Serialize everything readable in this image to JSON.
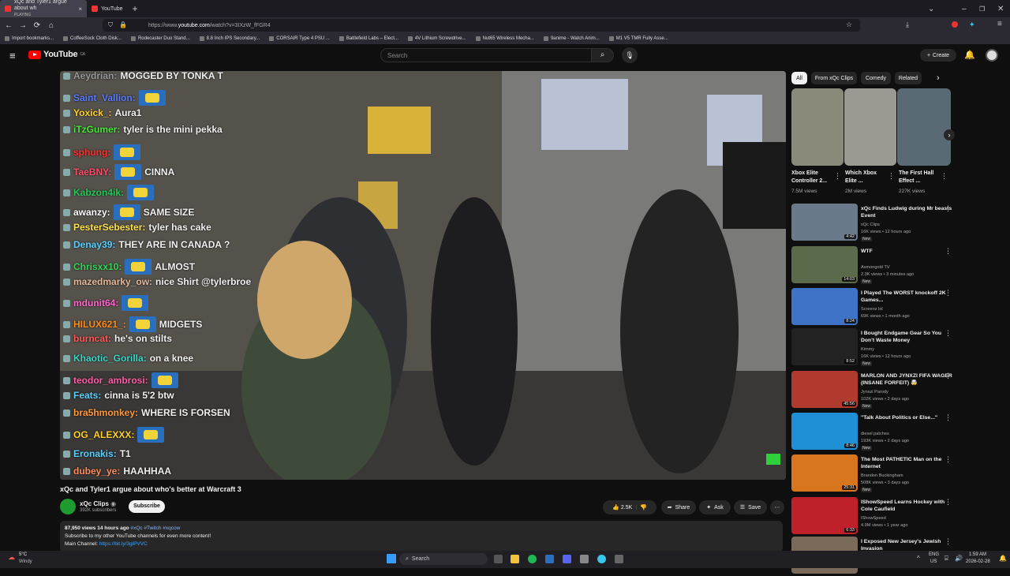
{
  "browser": {
    "tabs": [
      {
        "title": "xQc and Tyler1 argue about wh",
        "sub": "PLAYING",
        "close": "×"
      },
      {
        "title": "YouTube"
      }
    ],
    "newtab": "+",
    "url_prefix": "https://www.",
    "url_domain": "youtube.com",
    "url_path": "/watch?v=3IXzW_fFGR4",
    "bookmarks": [
      "Import bookmarks...",
      "CoffeeSock Cloth Disk...",
      "Rodecaster Duo Stand...",
      "8.8 Inch IPS Secondary...",
      "CORSAIR Type 4 PSU ...",
      "Battlefield Labs – Elect...",
      "4V Lithium Screwdrive...",
      "Nut65 Wireless Mecha...",
      "9anime - Watch Anim...",
      "M1 V5 TMR Fully Asse..."
    ]
  },
  "youtube": {
    "logo": "YouTube",
    "logo_region": "CA",
    "search_placeholder": "Search",
    "create_label": "Create"
  },
  "chat": [
    {
      "user": "Aeydrian:",
      "msg": "MOGGED BY TONKA T",
      "color": "#9a9a9a",
      "emote": false
    },
    {
      "user": "Saint_Vallion:",
      "msg": "",
      "color": "#5b7bff",
      "emote": true
    },
    {
      "user": "Yoxick_:",
      "msg": "Aura1",
      "color": "#ffd21f",
      "emote": false
    },
    {
      "user": "iTzGumer:",
      "msg": "tyler is the mini pekka",
      "color": "#47e83a",
      "emote": false
    },
    {
      "user": "sphung:",
      "msg": "",
      "color": "#ff3030",
      "emote": true
    },
    {
      "user": "TaeBNY:",
      "msg": "CINNA",
      "color": "#ff4d6a",
      "emote": true
    },
    {
      "user": "Kabzon4ik:",
      "msg": "",
      "color": "#27c95a",
      "emote": true
    },
    {
      "user": "awanzy:",
      "msg": "SAME SIZE",
      "color": "#ffffff",
      "emote": true
    },
    {
      "user": "PesterSebester:",
      "msg": "tyler has cake",
      "color": "#ffe14a",
      "emote": false
    },
    {
      "user": "Denay39:",
      "msg": "THEY ARE IN CANADA ?",
      "color": "#5ad0ff",
      "emote": false
    },
    {
      "user": "Chrisxx10:",
      "msg": "ALMOST",
      "color": "#3ad65a",
      "emote": true
    },
    {
      "user": "mazedmarky_ow:",
      "msg": "nice Shirt @tylerbroe",
      "color": "#e6b89a",
      "emote": false
    },
    {
      "user": "mdunit64:",
      "msg": "",
      "color": "#ff66cc",
      "emote": true
    },
    {
      "user": "HILUX621_:",
      "msg": "MIDGETS",
      "color": "#ff8c1a",
      "emote": true
    },
    {
      "user": "burncat:",
      "msg": "he's on stilts",
      "color": "#ff5a5a",
      "emote": false
    },
    {
      "user": "Khaotic_Gorilla:",
      "msg": "on a knee",
      "color": "#3ad6c8",
      "emote": false
    },
    {
      "user": "teodor_ambrosi:",
      "msg": "",
      "color": "#ff5ea8",
      "emote": true
    },
    {
      "user": "Feats:",
      "msg": "cinna is 5'2 btw",
      "color": "#5ad0ff",
      "emote": false
    },
    {
      "user": "bra5hmonkey:",
      "msg": "WHERE IS FORSEN",
      "color": "#ff9a3a",
      "emote": false
    },
    {
      "user": "OG_ALEXXX:",
      "msg": "",
      "color": "#ffd21f",
      "emote": true
    },
    {
      "user": "Eronakis:",
      "msg": "T1",
      "color": "#5ad0ff",
      "emote": false
    },
    {
      "user": "dubey_ye:",
      "msg": "HAAHHAA",
      "color": "#ff8c5a",
      "emote": false
    }
  ],
  "video": {
    "title": "xQc and Tyler1 argue about who's better at Warcraft 3",
    "channel": "xQc Clips",
    "subscribers": "392K subscribers",
    "subscribe_label": "Subscribe",
    "likes": "2.5K",
    "share_label": "Share",
    "ask_label": "Ask",
    "save_label": "Save",
    "views_line": "87,950 views  14 hours ago",
    "tags": "#xQc #Twitch #xqcow",
    "desc_line1": "Subscribe to my other YouTube channels for even more content!",
    "desc_line2_prefix": "Main Channel: ",
    "desc_link": "https://bit.ly/3glPVVC"
  },
  "chips": [
    "All",
    "From xQc Clips",
    "Comedy",
    "Related"
  ],
  "shorts": [
    {
      "title": "Xbox Elite Controller 2...",
      "views": "7.5M views"
    },
    {
      "title": "Which Xbox Elite ...",
      "views": "2M views"
    },
    {
      "title": "The First Hall Effect ...",
      "views": "227K views"
    }
  ],
  "related": [
    {
      "title": "xQc Finds Ludwig during Mr beasts Event",
      "channel": "xQc Clips",
      "meta": "16K views • 12 hours ago",
      "duration": "4:42",
      "new": "New",
      "color": "#6a7a8a"
    },
    {
      "title": "WTF",
      "channel": "Asmongold TV",
      "meta": "2.3K views • 3 minutes ago",
      "duration": "14:03",
      "new": "New",
      "color": "#5a6a4a"
    },
    {
      "title": "I Played The WORST knockoff 2K Games...",
      "channel": "Screenz lol",
      "meta": "69K views • 1 month ago",
      "duration": "8:24",
      "new": "",
      "color": "#3f73c7"
    },
    {
      "title": "I Bought Endgame Gear So You Don't Waste Money",
      "channel": "Kimmy",
      "meta": "16K views • 12 hours ago",
      "duration": "8:52",
      "new": "New",
      "color": "#222"
    },
    {
      "title": "MARLON AND JYNXZI FIFA WAGER (INSANE FORFEIT) 🤯",
      "channel": "Jynxzi Parody",
      "meta": "102K views • 2 days ago",
      "duration": "45:56",
      "new": "New",
      "color": "#b03a2e"
    },
    {
      "title": "\"Talk About Politics or Else...\"",
      "channel": "diesel patches",
      "meta": "193K views • 2 days ago",
      "duration": "8:46",
      "new": "New",
      "color": "#1f8fd6"
    },
    {
      "title": "The Most PATHETIC Man on the Internet",
      "channel": "Brandon Buckingham",
      "meta": "508K views • 3 days ago",
      "duration": "25:31",
      "new": "New",
      "color": "#d8761e"
    },
    {
      "title": "IShowSpeed Learns Hockey with Cole Caufield",
      "channel": "IShowSpeed",
      "meta": "4.9M views • 1 year ago",
      "duration": "6:33",
      "new": "",
      "color": "#c0202a"
    },
    {
      "title": "I Exposed New Jersey's Jewish Invasion",
      "channel": "",
      "meta": "",
      "duration": "",
      "new": "",
      "color": "#7a6a5a"
    }
  ],
  "taskbar": {
    "weather_temp": "5°C",
    "weather_desc": "Windy",
    "search_placeholder": "Search",
    "lang": "ENG",
    "region": "US",
    "time": "1:59 AM",
    "date": "2026-02-28"
  }
}
